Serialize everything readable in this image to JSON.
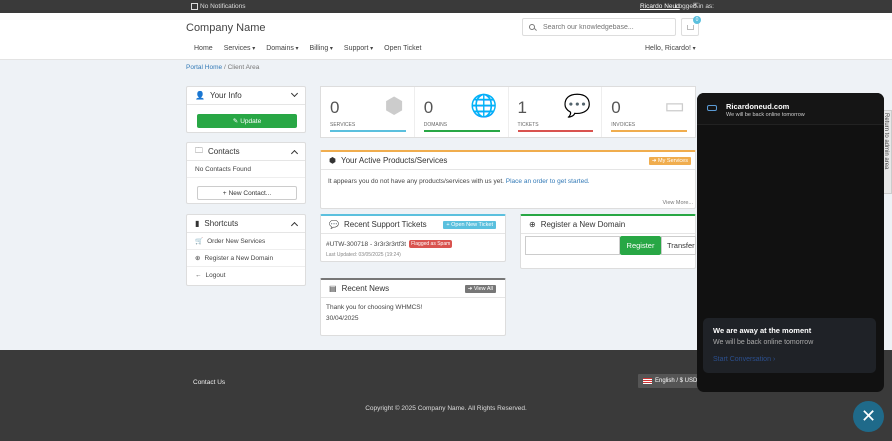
{
  "topbar": {
    "notifications": "No Notifications",
    "logged_in_label": "Logged in as:",
    "user_name": "Ricardo Neud"
  },
  "header": {
    "brand": "Company Name",
    "search_placeholder": "Search our knowledgebase...",
    "cart_count": "0",
    "nav": [
      "Home",
      "Services",
      "Domains",
      "Billing",
      "Support",
      "Open Ticket"
    ],
    "greeting": "Hello, Ricardo!"
  },
  "breadcrumb": {
    "home": "Portal Home",
    "sep": "/",
    "current": "Client Area"
  },
  "your_info": {
    "title": "Your Info",
    "update": "Update"
  },
  "contacts": {
    "title": "Contacts",
    "empty": "No Contacts Found",
    "new_contact": "New Contact..."
  },
  "shortcuts": {
    "title": "Shortcuts",
    "items": [
      "Order New Services",
      "Register a New Domain",
      "Logout"
    ]
  },
  "stats": [
    {
      "num": "0",
      "label": "SERVICES",
      "color": "#5bc0de"
    },
    {
      "num": "0",
      "label": "DOMAINS",
      "color": "#28a745"
    },
    {
      "num": "1",
      "label": "TICKETS",
      "color": "#d9534f"
    },
    {
      "num": "0",
      "label": "INVOICES",
      "color": "#f0ad4e"
    }
  ],
  "products": {
    "title": "Your Active Products/Services",
    "btn": "My Services",
    "msg": "It appears you do not have any products/services with us yet.",
    "link": "Place an order to get started.",
    "view_more": "View More..."
  },
  "tickets": {
    "title": "Recent Support Tickets",
    "btn": "Open New Ticket",
    "ticket": "#UTW-300718 - 3r3r3r3rtf3t",
    "flag": "Flagged as Spam",
    "updated": "Last Updated: 03/05/2025 (19:24)"
  },
  "register": {
    "title": "Register a New Domain",
    "register": "Register",
    "transfer": "Transfer"
  },
  "news": {
    "title": "Recent News",
    "btn": "View All",
    "item": "Thank you for choosing WHMCS!",
    "date": "30/04/2025"
  },
  "footer": {
    "contact": "Contact Us",
    "lang": "English / $ USD",
    "copy": "Copyright © 2025 Company Name. All Rights Reserved."
  },
  "chat": {
    "title": "Ricardoneud.com",
    "subtitle": "We will be back online tomorrow",
    "away_title": "We are away at the moment",
    "away_sub": "We will be back online tomorrow",
    "start": "Start Conversation"
  },
  "side_tab": "Return to admin area"
}
